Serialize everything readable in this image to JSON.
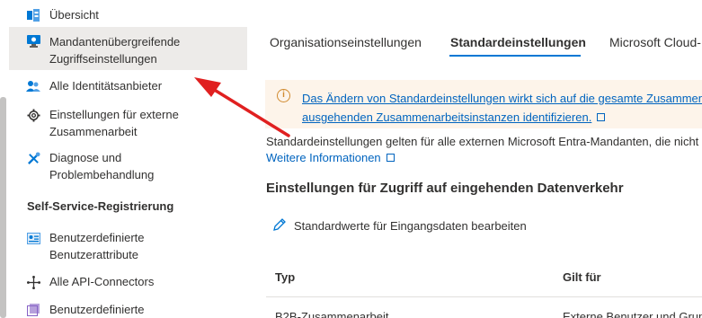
{
  "sidebar": {
    "items": [
      {
        "label": "Übersicht",
        "icon": "overview-icon"
      },
      {
        "label": "Mandantenübergreifende\nZugriffseinstellungen",
        "icon": "cross-tenant-icon"
      },
      {
        "label": "Alle Identitätsanbieter",
        "icon": "identity-providers-icon"
      },
      {
        "label": "Einstellungen für externe\nZusammenarbeit",
        "icon": "gear-icon"
      },
      {
        "label": "Diagnose und\nProblembehandlung",
        "icon": "tools-icon"
      }
    ],
    "section_header": "Self-Service-Registrierung",
    "section_items": [
      {
        "label": "Benutzerdefinierte\nBenutzerattribute",
        "icon": "user-attributes-icon"
      },
      {
        "label": "Alle API-Connectors",
        "icon": "api-connectors-icon"
      },
      {
        "label": "Benutzerdefinierte",
        "icon": "custom-icon"
      }
    ]
  },
  "tabs": [
    {
      "label": "Organisationseinstellungen"
    },
    {
      "label": "Standardeinstellungen"
    },
    {
      "label": "Microsoft Cloud-"
    }
  ],
  "banner": {
    "line1": "Das Ändern von Standardeinstellungen wirkt sich auf die gesamte Zusammena",
    "line2": "ausgehenden Zusammenarbeitsinstanzen identifizieren."
  },
  "description": "Standardeinstellungen gelten für alle externen Microsoft Entra-Mandanten, die nicht",
  "more_link": "Weitere Informationen",
  "inbound_title": "Einstellungen für Zugriff auf eingehenden Datenverkehr",
  "edit_button": "Standardwerte für Eingangsdaten bearbeiten",
  "table": {
    "headers": [
      "Typ",
      "Gilt für"
    ],
    "rows": [
      [
        "B2B-Zusammenarbeit",
        "Externe Benutzer und Grup"
      ]
    ]
  },
  "colors": {
    "accent": "#0078d4",
    "link": "#0064bf",
    "warning": "#d08a2f",
    "arrow": "#e02020"
  }
}
